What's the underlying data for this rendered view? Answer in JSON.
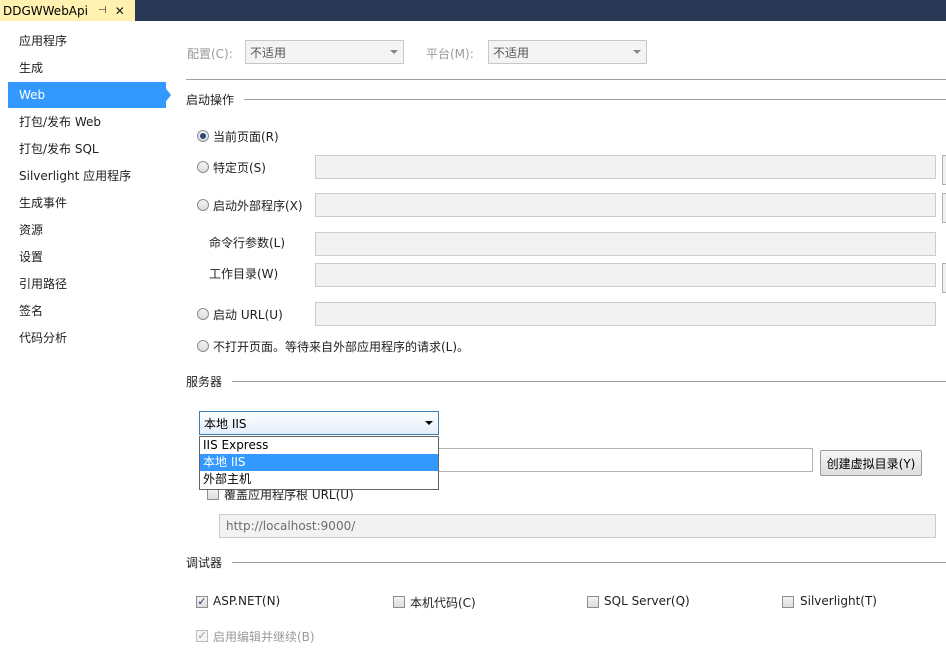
{
  "window": {
    "tab_title": "DDGWWebApi",
    "pin_icon": "pin-icon",
    "close_icon": "close-icon"
  },
  "nav": {
    "items": [
      {
        "label": "应用程序"
      },
      {
        "label": "生成"
      },
      {
        "label": "Web",
        "active": true
      },
      {
        "label": "打包/发布 Web"
      },
      {
        "label": "打包/发布 SQL"
      },
      {
        "label": "Silverlight 应用程序"
      },
      {
        "label": "生成事件"
      },
      {
        "label": "资源"
      },
      {
        "label": "设置"
      },
      {
        "label": "引用路径"
      },
      {
        "label": "签名"
      },
      {
        "label": "代码分析"
      }
    ]
  },
  "config": {
    "config_label": "配置(C):",
    "config_value": "不适用",
    "platform_label": "平台(M):",
    "platform_value": "不适用"
  },
  "start_action": {
    "title": "启动操作",
    "current_page": "当前页面(R)",
    "specific_page": "特定页(S)",
    "external_program": "启动外部程序(X)",
    "cmd_args": "命令行参数(L)",
    "work_dir": "工作目录(W)",
    "start_url": "启动 URL(U)",
    "dont_open": "不打开页面。等待来自外部应用程序的请求(L)。"
  },
  "servers": {
    "title": "服务器",
    "selected": "本地 IIS",
    "options": [
      "IIS Express",
      "本地 IIS",
      "外部主机"
    ],
    "create_vdir_button": "创建虚拟目录(Y)",
    "override_root_url": "覆盖应用程序根 URL(U)",
    "root_url_value": "http://localhost:9000/"
  },
  "debuggers": {
    "title": "调试器",
    "aspnet": "ASP.NET(N)",
    "native": "本机代码(C)",
    "sqlserver": "SQL Server(Q)",
    "silverlight": "Silverlight(T)",
    "edit_continue": "启用编辑并继续(B)"
  },
  "colors": {
    "tab_bar": "#293955",
    "active_tab": "#fff1b0",
    "selection": "#3399ff"
  }
}
